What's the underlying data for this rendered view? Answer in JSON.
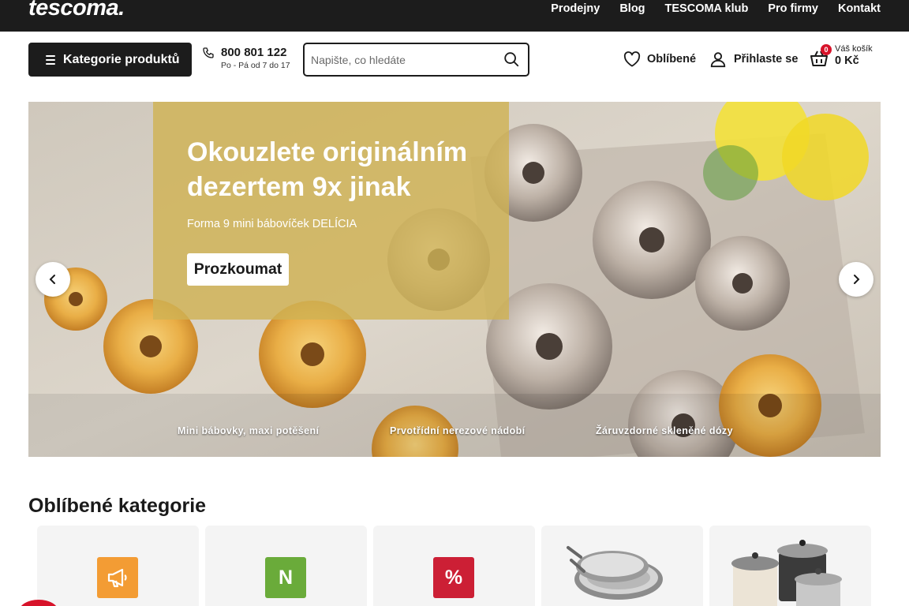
{
  "header": {
    "logo": "tescoma.",
    "nav": [
      "Prodejny",
      "Blog",
      "TESCOMA klub",
      "Pro firmy",
      "Kontakt"
    ],
    "category_button": "Kategorie produktů",
    "phone_number": "800 801 122",
    "phone_hours": "Po - Pá od 7 do 17",
    "search_placeholder": "Napište, co hledáte",
    "favorites": "Oblíbené",
    "login": "Přihlaste se",
    "cart_label": "Váš košík",
    "cart_price": "0 Kč",
    "cart_count": "0"
  },
  "hero": {
    "title": "Okouzlete originálním dezertem 9x jinak",
    "subtitle": "Forma 9 mini bábovíček DELÍCIA",
    "cta": "Prozkoumat",
    "slides": [
      "Mini bábovky, maxi potěšení",
      "Prvotřídní nerezové nádobí",
      "Žáruvzdorné skleněné dózy"
    ]
  },
  "categories": {
    "title": "Oblíbené kategorie",
    "items": [
      {
        "icon": "megaphone-icon",
        "color": "#f39c34"
      },
      {
        "icon": "N",
        "color": "#6aab3a"
      },
      {
        "icon": "%",
        "color": "#cc1f35"
      },
      {
        "icon": "frying-pans-image"
      },
      {
        "icon": "cooking-pots-image"
      }
    ]
  },
  "colors": {
    "dark": "#1c1c1c",
    "accent_red": "#d7132a",
    "overlay_gold": "#d0b254"
  }
}
